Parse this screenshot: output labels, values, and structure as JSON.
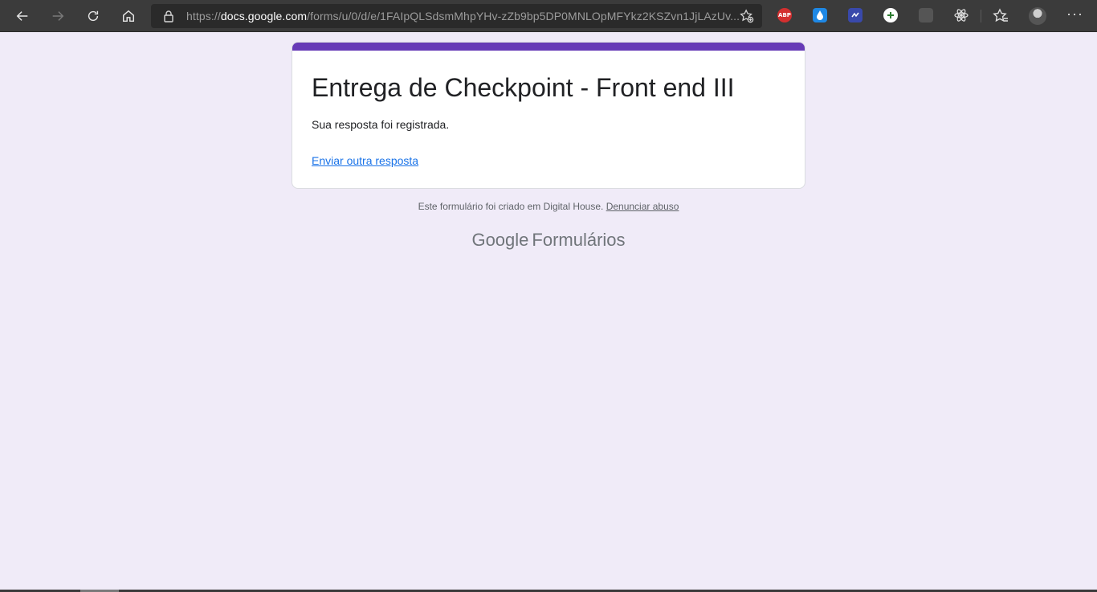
{
  "browser": {
    "url_scheme": "https://",
    "url_host": "docs.google.com",
    "url_path": "/forms/u/0/d/e/1FAIpQLSdsmMhpYHv-zZb9bp5DP0MNLOpMFYkz2KSZvn1JjLAzUv...",
    "extensions": {
      "abp_label": "ABP"
    }
  },
  "form": {
    "title": "Entrega de Checkpoint - Front end III",
    "confirmation": "Sua resposta foi registrada.",
    "another_response_link": "Enviar outra resposta",
    "accent_color": "#673ab7"
  },
  "footer": {
    "created_text": "Este formulário foi criado em Digital House.",
    "report_link": "Denunciar abuso",
    "brand_google": "Google",
    "brand_product": "Formulários"
  }
}
